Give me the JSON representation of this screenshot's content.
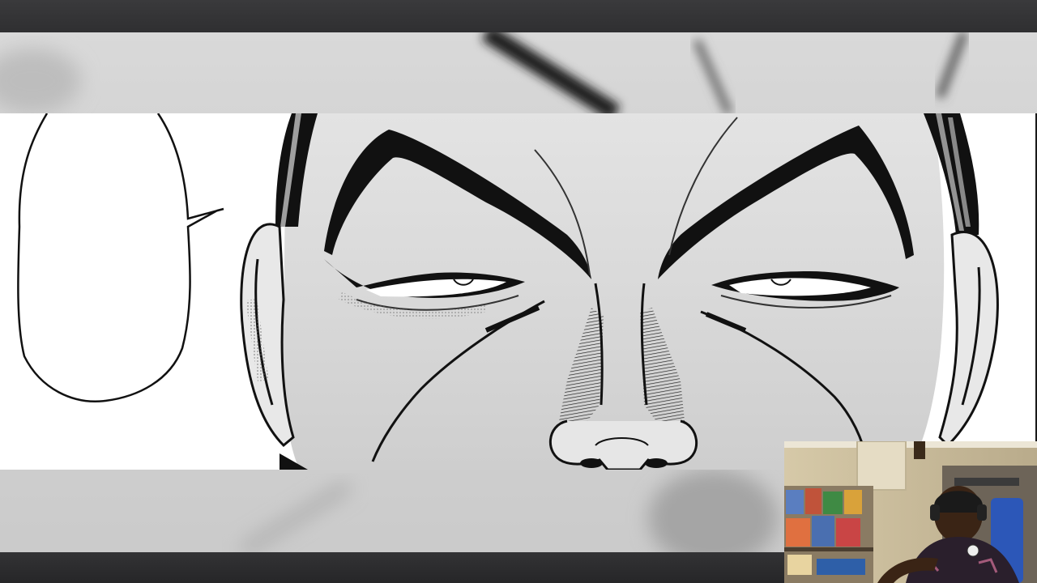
{
  "video_player": {
    "top_bar": {},
    "bottom_bar": {}
  },
  "manga_panel": {
    "speech_bubble_text": "",
    "subject": "close-up-face-eyes"
  },
  "webcam_overlay": {
    "subject": "streamer-with-headset",
    "background": "shelf-with-figures"
  },
  "colors": {
    "chrome": "#2d2d2f",
    "page": "#ffffff",
    "ink": "#111111",
    "screentone": "#d8d8d8"
  }
}
